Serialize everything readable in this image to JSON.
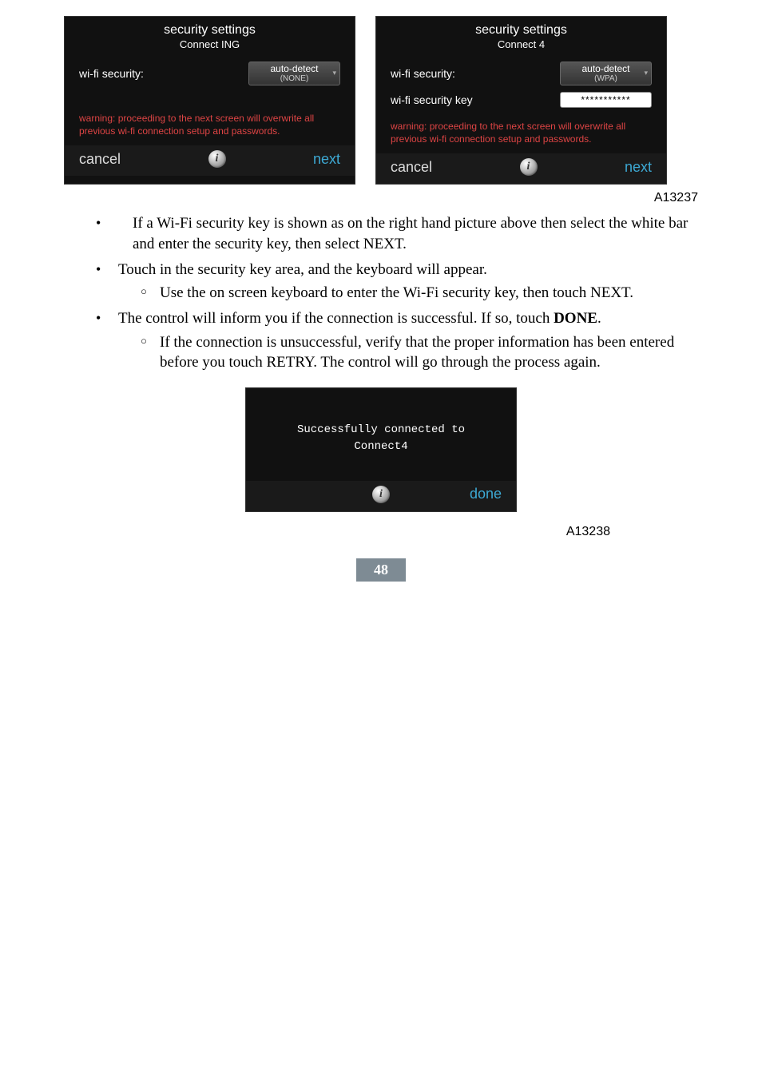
{
  "screenA": {
    "title": "security settings",
    "subtitle": "Connect ING",
    "securityLabel": "wi-fi security:",
    "dropdownMain": "auto-detect",
    "dropdownSub": "(NONE)",
    "warning": "warning: proceeding to the next screen will overwrite all previous wi-fi connection setup and passwords.",
    "cancel": "cancel",
    "next": "next"
  },
  "screenB": {
    "title": "security settings",
    "subtitle": "Connect 4",
    "securityLabel": "wi-fi security:",
    "dropdownMain": "auto-detect",
    "dropdownSub": "(WPA)",
    "keyLabel": "wi-fi security key",
    "keyValue": "***********",
    "warning": "warning: proceeding to the next screen will overwrite all previous wi-fi connection setup and passwords.",
    "cancel": "cancel",
    "next": "next"
  },
  "figId1": "A13237",
  "bullets": {
    "b1": "If a Wi-Fi security key is shown as on the right hand picture above then select the white bar and enter the security key, then select NEXT.",
    "b2": "Touch in the security key area, and the keyboard will appear.",
    "b2a": "Use the on screen keyboard to enter the Wi-Fi security key, then touch NEXT.",
    "b3a": "The control will inform you if the connection is successful. If so, touch ",
    "b3bold": "DONE",
    "b3b": ".",
    "b3sub": "If the connection is unsuccessful, verify that the proper information has been entered before you touch RETRY. The control will go through the process again."
  },
  "screenC": {
    "line1": "Successfully connected to",
    "line2": "Connect4",
    "done": "done"
  },
  "figId2": "A13238",
  "pageNum": "48",
  "infoGlyph": "i"
}
